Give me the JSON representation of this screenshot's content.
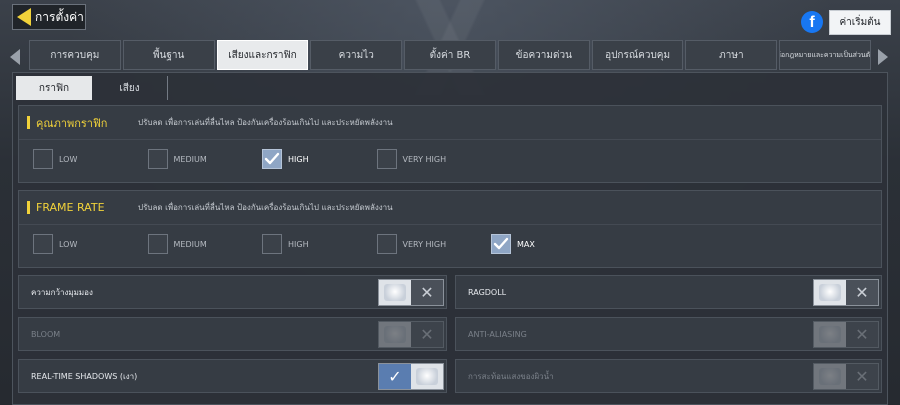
{
  "header": {
    "title": "การตั้งค่า",
    "reset_label": "ค่าเริ่มต้น",
    "facebook_glyph": "f"
  },
  "tabs": [
    {
      "label": "การควบคุม",
      "active": false
    },
    {
      "label": "พื้นฐาน",
      "active": false
    },
    {
      "label": "เสียงและกราฟิก",
      "active": true
    },
    {
      "label": "ความไว",
      "active": false
    },
    {
      "label": "ตั้งค่า BR",
      "active": false
    },
    {
      "label": "ข้อความด่วน",
      "active": false
    },
    {
      "label": "อุปกรณ์ควบคุม",
      "active": false
    },
    {
      "label": "ภาษา",
      "active": false
    },
    {
      "label": "ข้อกฎหมายและความเป็นส่วนตัว",
      "active": false
    }
  ],
  "subtabs": [
    {
      "label": "กราฟิก",
      "active": true
    },
    {
      "label": "เสียง",
      "active": false
    }
  ],
  "graphics_quality": {
    "title": "คุณภาพกราฟิก",
    "desc": "ปรับลด เพื่อการเล่นที่ลื่นไหล ป้องกันเครื่องร้อนเกินไป และประหยัดพลังงาน",
    "options": [
      "LOW",
      "MEDIUM",
      "HIGH",
      "VERY HIGH"
    ],
    "selected": "HIGH"
  },
  "frame_rate": {
    "title": "FRAME RATE",
    "desc": "ปรับลด เพื่อการเล่นที่ลื่นไหล ป้องกันเครื่องร้อนเกินไป และประหยัดพลังงาน",
    "options": [
      "LOW",
      "MEDIUM",
      "HIGH",
      "VERY HIGH",
      "MAX"
    ],
    "selected": "MAX"
  },
  "toggles_left": [
    {
      "label": "ความกว้างมุมมอง",
      "state": "off",
      "enabled": true
    },
    {
      "label": "BLOOM",
      "state": "off",
      "enabled": false
    },
    {
      "label": "REAL-TIME SHADOWS (เงา)",
      "state": "on",
      "enabled": true
    }
  ],
  "toggles_right": [
    {
      "label": "RAGDOLL",
      "state": "off",
      "enabled": true
    },
    {
      "label": "ANTI-ALIASING",
      "state": "off",
      "enabled": false
    },
    {
      "label": "การสะท้อนแสงของผิวน้ำ",
      "state": "off",
      "enabled": false
    }
  ],
  "colors": {
    "accent": "#f1d23a",
    "checked": "#8fa6c5",
    "toggle_on": "#5a7db0"
  },
  "icons": {
    "back": "back-arrow-icon",
    "facebook": "facebook-icon",
    "check": "check-icon",
    "cross": "x-icon"
  }
}
